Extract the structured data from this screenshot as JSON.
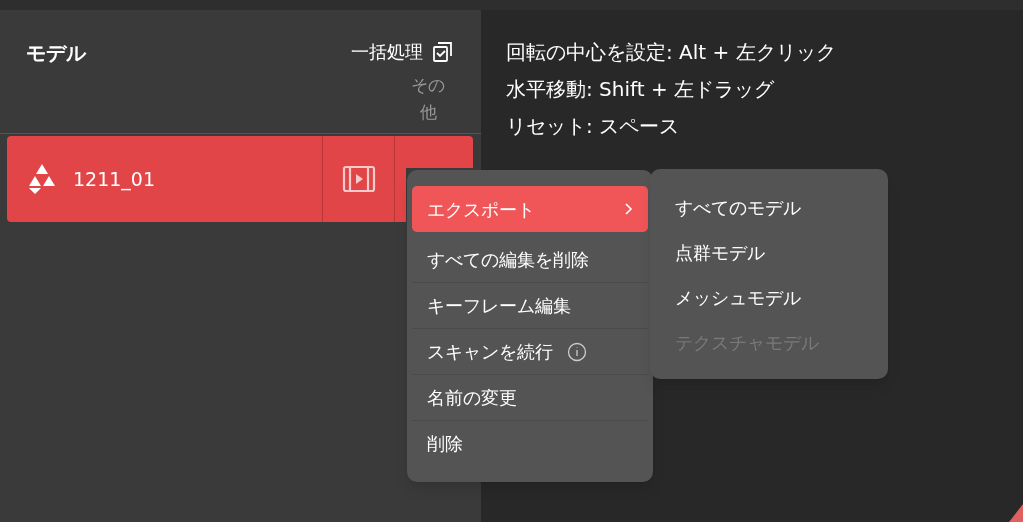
{
  "model_panel": {
    "title": "モデル",
    "batch_action": "一括処理",
    "column_header": "その他",
    "rows": [
      {
        "name": "1211_01",
        "selected": true
      }
    ]
  },
  "hints": [
    "回転の中心を設定: Alt + 左クリック",
    "水平移動: Shift + 左ドラッグ",
    "リセット: スペース"
  ],
  "context_menu": {
    "items": [
      {
        "label": "エクスポート",
        "selected": true,
        "submenu": true,
        "info": false
      },
      {
        "label": "すべての編集を削除",
        "selected": false,
        "submenu": false,
        "info": false
      },
      {
        "label": "キーフレーム編集",
        "selected": false,
        "submenu": false,
        "info": false
      },
      {
        "label": "スキャンを続行",
        "selected": false,
        "submenu": false,
        "info": true
      },
      {
        "label": "名前の変更",
        "selected": false,
        "submenu": false,
        "info": false
      },
      {
        "label": "削除",
        "selected": false,
        "submenu": false,
        "info": false
      }
    ]
  },
  "submenu": {
    "items": [
      {
        "label": "すべてのモデル",
        "disabled": false
      },
      {
        "label": "点群モデル",
        "disabled": false
      },
      {
        "label": "メッシュモデル",
        "disabled": false
      },
      {
        "label": "テクスチャモデル",
        "disabled": true
      }
    ]
  }
}
